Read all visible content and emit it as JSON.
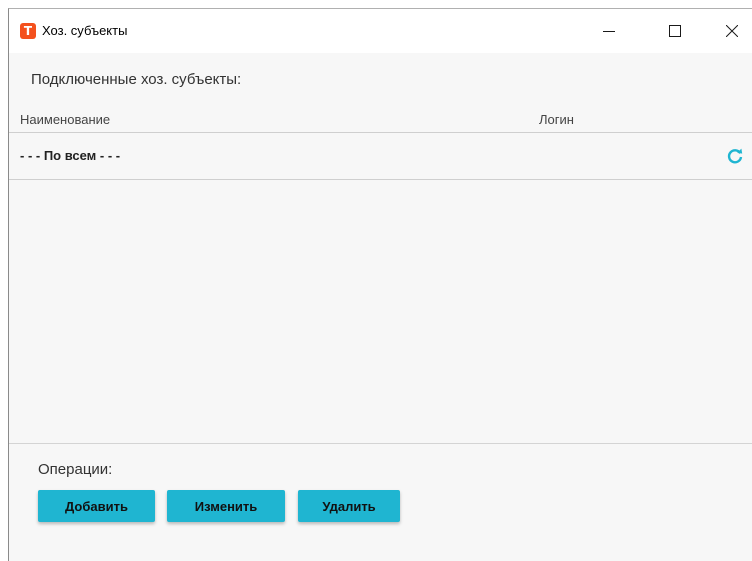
{
  "window": {
    "title": "Хоз. субъекты",
    "app_icon_letter": "T",
    "app_icon_color": "#f4511e"
  },
  "main": {
    "section_title": "Подключенные хоз. субъекты:",
    "columns": [
      "Наименование",
      "Логин"
    ],
    "rows": [
      {
        "name": "- - - По всем - - -",
        "login": "",
        "action_icon": "refresh-icon"
      }
    ]
  },
  "operations": {
    "label": "Операции:",
    "buttons": [
      "Добавить",
      "Изменить",
      "Удалить"
    ],
    "button_color": "#1fb5d1"
  },
  "accent_color": "#1fb5d1"
}
